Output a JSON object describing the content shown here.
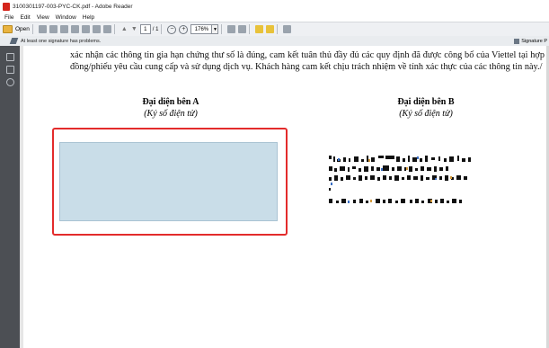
{
  "window": {
    "title": "3100301197-003-PYC-CK.pdf - Adobe Reader"
  },
  "menu": [
    "File",
    "Edit",
    "View",
    "Window",
    "Help"
  ],
  "toolbar": {
    "open_label": "Open",
    "page_current": "1",
    "page_total": "/ 1",
    "zoom_value": "176%",
    "minus": "−",
    "plus": "+"
  },
  "signature_bar": {
    "message": "At least one signature has problems.",
    "panel_button": "Signature P"
  },
  "document": {
    "paragraph": "xác nhận các thông tin gia hạn chứng thư số là đúng, cam kết tuân thủ đầy đủ các quy định đã được công bố của Viettel tại hợp đồng/phiếu yêu cầu cung cấp và sử dụng dịch vụ. Khách hàng cam kết chịu trách nhiệm về tính xác thực của các thông tin này./",
    "party_a_title": "Đại diện bên A",
    "party_a_sub": "(Ký số điện tử)",
    "party_b_title": "Đại diện bên B",
    "party_b_sub": "(Ký số điện tử)"
  },
  "colors": {
    "highlight_border": "#e32b2b",
    "signature_field": "#c9dde8"
  }
}
